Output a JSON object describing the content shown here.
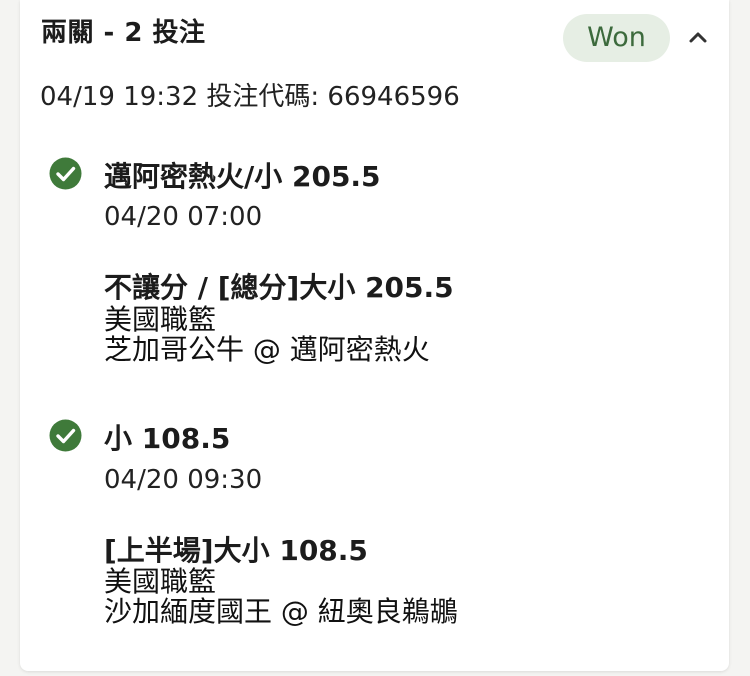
{
  "header": {
    "bet_type": "兩關 - 2 投注",
    "status": "Won",
    "meta": "04/19 19:32 投注代碼: 66946596"
  },
  "legs": [
    {
      "selection": "邁阿密熱火/小 205.5",
      "time": "04/20 07:00",
      "market": "不讓分 / [總分]大小 205.5",
      "league": "美國職籃",
      "matchup": "芝加哥公牛 @ 邁阿密熱火"
    },
    {
      "selection": "小 108.5",
      "time": "04/20 09:30",
      "market": "[上半場]大小 108.5",
      "league": "美國職籃",
      "matchup": "沙加緬度國王 @ 紐奧良鵜鶘"
    }
  ],
  "icons": {
    "check": "check-circle-icon",
    "collapse": "chevron-up-icon"
  },
  "colors": {
    "won_badge_bg": "#e6eee4",
    "won_text": "#3c6a3c",
    "check_green": "#3f7a3a"
  }
}
